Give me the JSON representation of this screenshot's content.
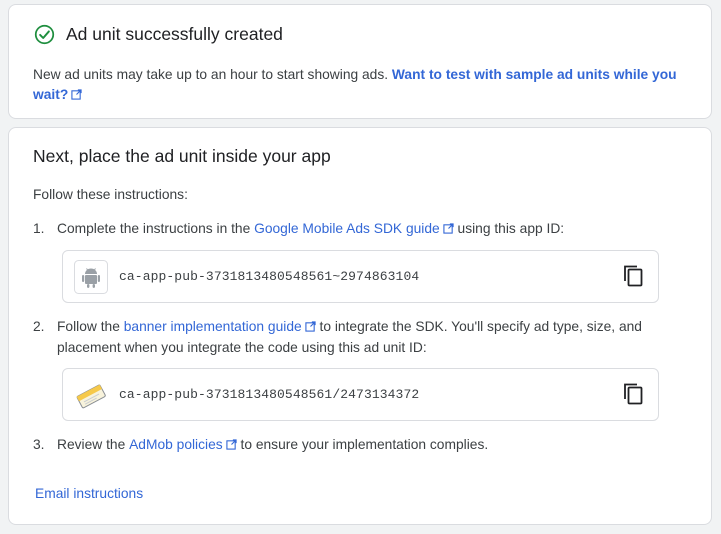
{
  "success": {
    "title": "Ad unit successfully created",
    "description": "New ad units may take up to an hour to start showing ads. ",
    "test_link": "Want to test with sample ad units while you wait?",
    "check_color": "#1e8e3e"
  },
  "next": {
    "title": "Next, place the ad unit inside your app",
    "follow": "Follow these instructions:",
    "steps": [
      {
        "num": "1.",
        "pre": "Complete the instructions in the ",
        "link": "Google Mobile Ads SDK guide",
        "post": " using this app ID:"
      },
      {
        "num": "2.",
        "pre": "Follow the ",
        "link": "banner implementation guide",
        "post": " to integrate the SDK. You'll specify ad type, size, and placement when you integrate the code using this ad unit ID:"
      },
      {
        "num": "3.",
        "pre": "Review the ",
        "link": "AdMob policies",
        "post": " to ensure your implementation complies."
      }
    ],
    "app_id": "ca-app-pub-3731813480548561~2974863104",
    "app_id_icon": "android-icon",
    "ad_unit_id": "ca-app-pub-3731813480548561/2473134372",
    "ad_unit_icon": "banner-ad-icon",
    "email_link": "Email instructions"
  },
  "colors": {
    "link": "#3367d6",
    "border": "#dadce0",
    "background": "#f1f3f4"
  }
}
